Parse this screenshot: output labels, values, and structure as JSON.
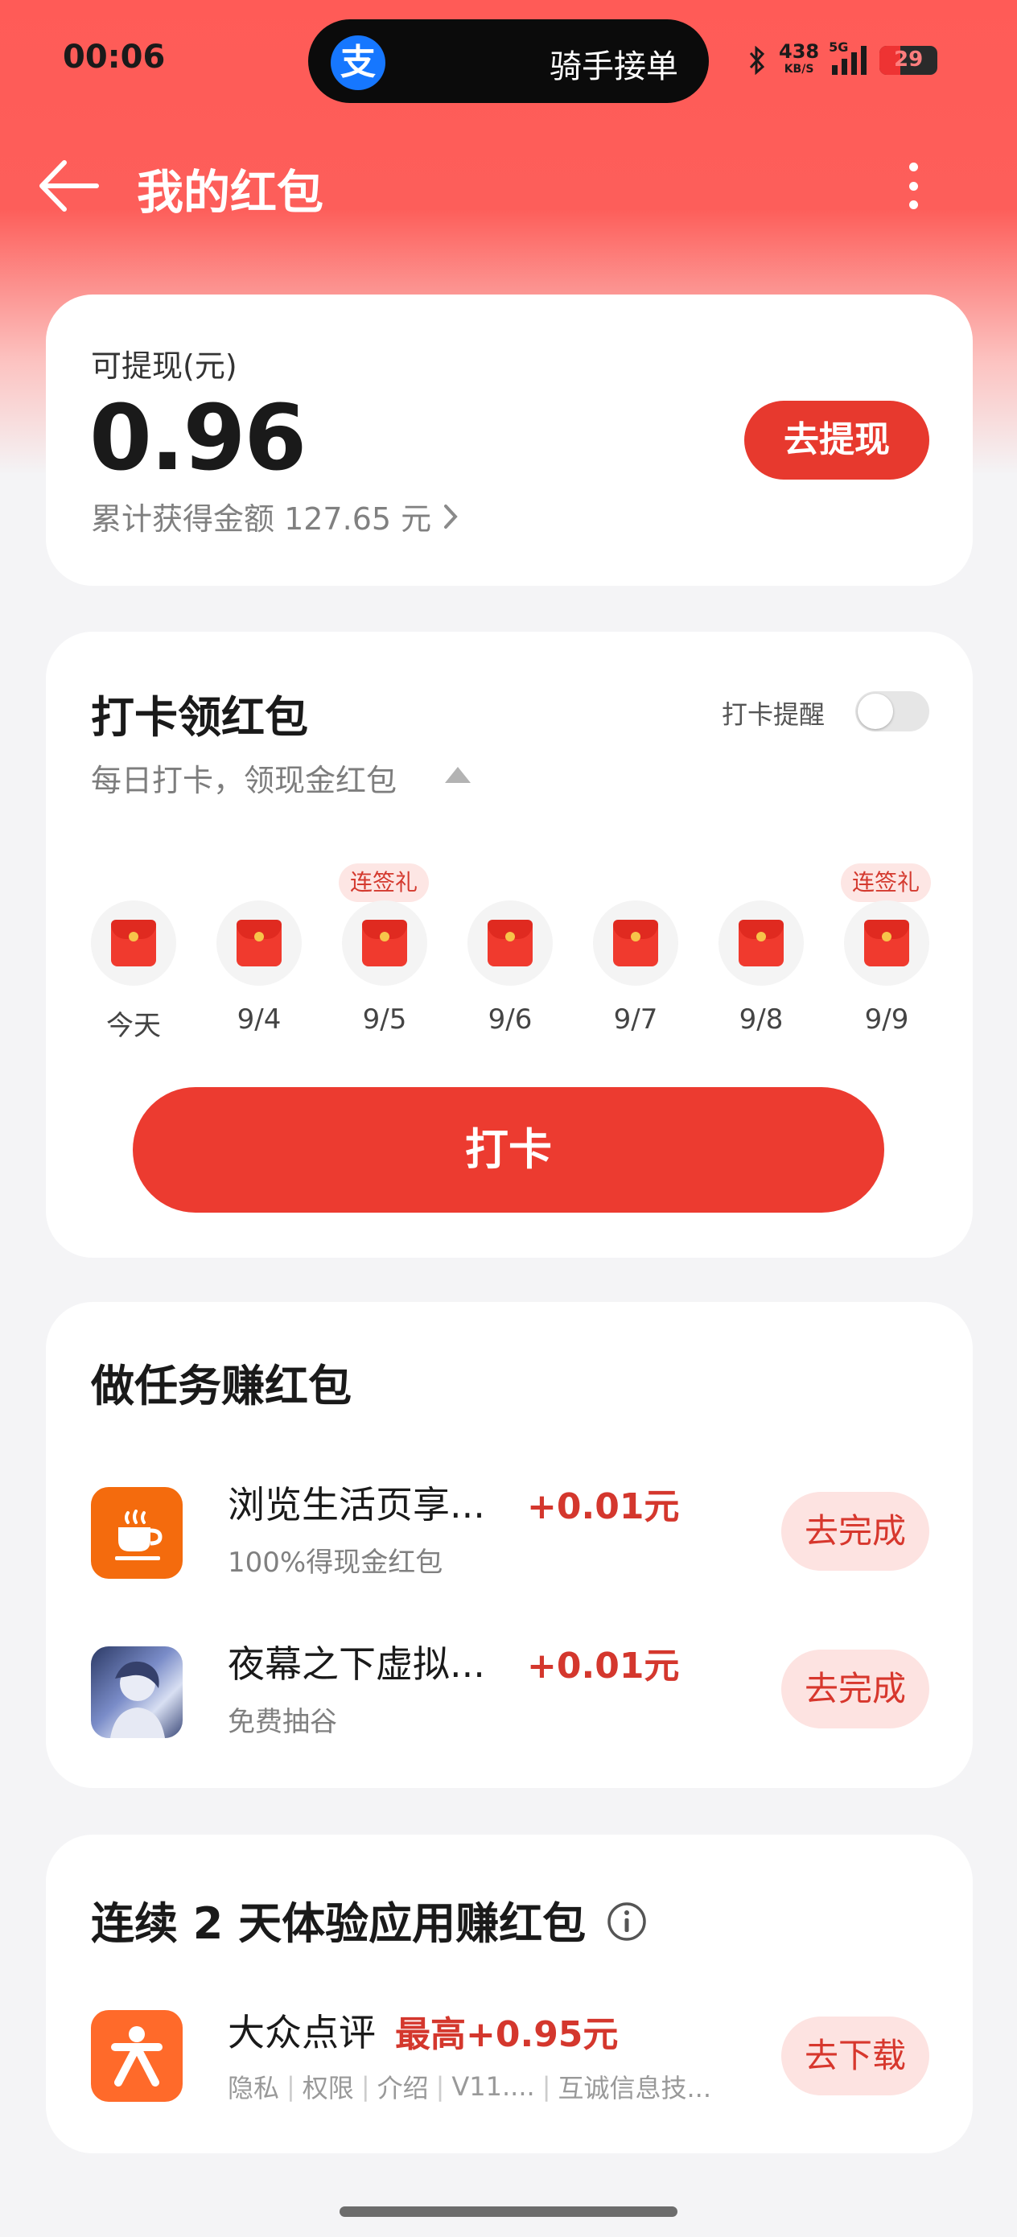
{
  "status": {
    "time": "00:06",
    "island_text": "骑手接单",
    "island_logo": "支",
    "speed_value": "438",
    "speed_unit": "KB/S",
    "network": "5G",
    "battery": "29"
  },
  "nav": {
    "title": "我的红包"
  },
  "balance": {
    "label": "可提现(元)",
    "amount": "0.96",
    "cumulative": "累计获得金额 127.65 元",
    "withdraw_label": "去提现"
  },
  "checkin": {
    "title": "打卡领红包",
    "subtitle": "每日打卡，领现金红包",
    "reminder_label": "打卡提醒",
    "reminder_on": false,
    "days": [
      {
        "label": "今天",
        "badge": ""
      },
      {
        "label": "9/4",
        "badge": ""
      },
      {
        "label": "9/5",
        "badge": "连签礼"
      },
      {
        "label": "9/6",
        "badge": ""
      },
      {
        "label": "9/7",
        "badge": ""
      },
      {
        "label": "9/8",
        "badge": ""
      },
      {
        "label": "9/9",
        "badge": "连签礼"
      }
    ],
    "button_label": "打卡"
  },
  "tasks": {
    "title": "做任务赚红包",
    "items": [
      {
        "name": "浏览生活页享...",
        "reward": "+0.01元",
        "desc": "100%得现金红包",
        "action": "去完成",
        "icon": "coffee-cup-icon"
      },
      {
        "name": "夜幕之下虚拟...",
        "reward": "+0.01元",
        "desc": "免费抽谷",
        "action": "去完成",
        "icon": "anime-character-icon"
      }
    ]
  },
  "apps": {
    "title": "连续 2 天体验应用赚红包",
    "items": [
      {
        "name": "大众点评",
        "reward": "最高+0.95元",
        "meta": [
          "隐私",
          "权限",
          "介绍",
          "V11....",
          "互诚信息技..."
        ],
        "action": "去下载",
        "icon": "dianping-logo-icon"
      }
    ]
  },
  "colors": {
    "primary_red": "#e7392e",
    "header_red": "#ff5b57",
    "reward_red": "#d4372d"
  }
}
